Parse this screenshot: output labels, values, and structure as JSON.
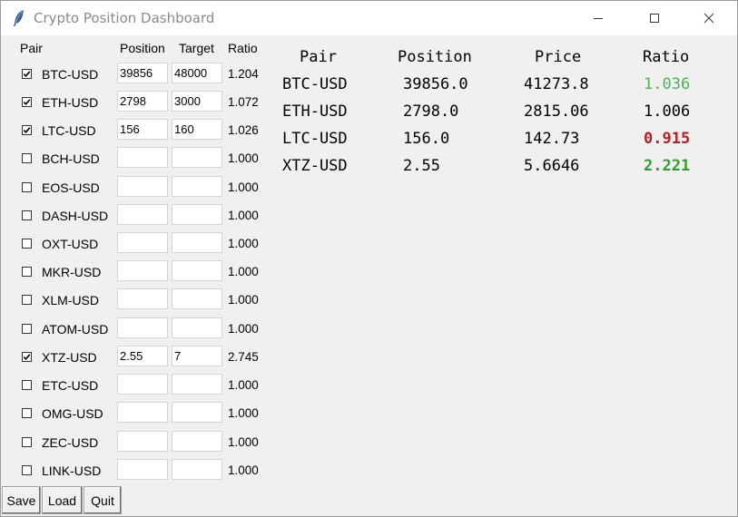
{
  "window": {
    "title": "Crypto Position Dashboard"
  },
  "form": {
    "headers": {
      "pair": "Pair",
      "position": "Position",
      "target": "Target",
      "ratio": "Ratio"
    },
    "rows": [
      {
        "pair": "BTC-USD",
        "checked": true,
        "position": "39856",
        "target": "48000",
        "ratio": "1.204"
      },
      {
        "pair": "ETH-USD",
        "checked": true,
        "position": "2798",
        "target": "3000",
        "ratio": "1.072"
      },
      {
        "pair": "LTC-USD",
        "checked": true,
        "position": "156",
        "target": "160",
        "ratio": "1.026"
      },
      {
        "pair": "BCH-USD",
        "checked": false,
        "position": "",
        "target": "",
        "ratio": "1.000"
      },
      {
        "pair": "EOS-USD",
        "checked": false,
        "position": "",
        "target": "",
        "ratio": "1.000"
      },
      {
        "pair": "DASH-USD",
        "checked": false,
        "position": "",
        "target": "",
        "ratio": "1.000"
      },
      {
        "pair": "OXT-USD",
        "checked": false,
        "position": "",
        "target": "",
        "ratio": "1.000"
      },
      {
        "pair": "MKR-USD",
        "checked": false,
        "position": "",
        "target": "",
        "ratio": "1.000"
      },
      {
        "pair": "XLM-USD",
        "checked": false,
        "position": "",
        "target": "",
        "ratio": "1.000"
      },
      {
        "pair": "ATOM-USD",
        "checked": false,
        "position": "",
        "target": "",
        "ratio": "1.000"
      },
      {
        "pair": "XTZ-USD",
        "checked": true,
        "position": "2.55",
        "target": "7",
        "ratio": "2.745"
      },
      {
        "pair": "ETC-USD",
        "checked": false,
        "position": "",
        "target": "",
        "ratio": "1.000"
      },
      {
        "pair": "OMG-USD",
        "checked": false,
        "position": "",
        "target": "",
        "ratio": "1.000"
      },
      {
        "pair": "ZEC-USD",
        "checked": false,
        "position": "",
        "target": "",
        "ratio": "1.000"
      },
      {
        "pair": "LINK-USD",
        "checked": false,
        "position": "",
        "target": "",
        "ratio": "1.000"
      }
    ]
  },
  "buttons": {
    "save": "Save",
    "load": "Load",
    "quit": "Quit"
  },
  "summary": {
    "headers": {
      "pair": "Pair",
      "position": "Position",
      "price": "Price",
      "ratio": "Ratio"
    },
    "rows": [
      {
        "pair": "BTC-USD",
        "position": "39856.0",
        "price": "41273.8",
        "ratio": "1.036",
        "ratio_color": "#4caf50",
        "bold": false
      },
      {
        "pair": "ETH-USD",
        "position": "2798.0",
        "price": "2815.06",
        "ratio": "1.006",
        "ratio_color": "#000000",
        "bold": false
      },
      {
        "pair": "LTC-USD",
        "position": "156.0",
        "price": "142.73",
        "ratio": "0.915",
        "ratio_color": "#b22222",
        "bold": true
      },
      {
        "pair": "XTZ-USD",
        "position": "2.55",
        "price": "5.6646",
        "ratio": "2.221",
        "ratio_color": "#2e9e2e",
        "bold": true
      }
    ]
  },
  "icons": {
    "app": "feather-icon",
    "minimize": "minimize-icon",
    "maximize": "maximize-icon",
    "close": "close-icon",
    "check": "checkmark-icon"
  }
}
